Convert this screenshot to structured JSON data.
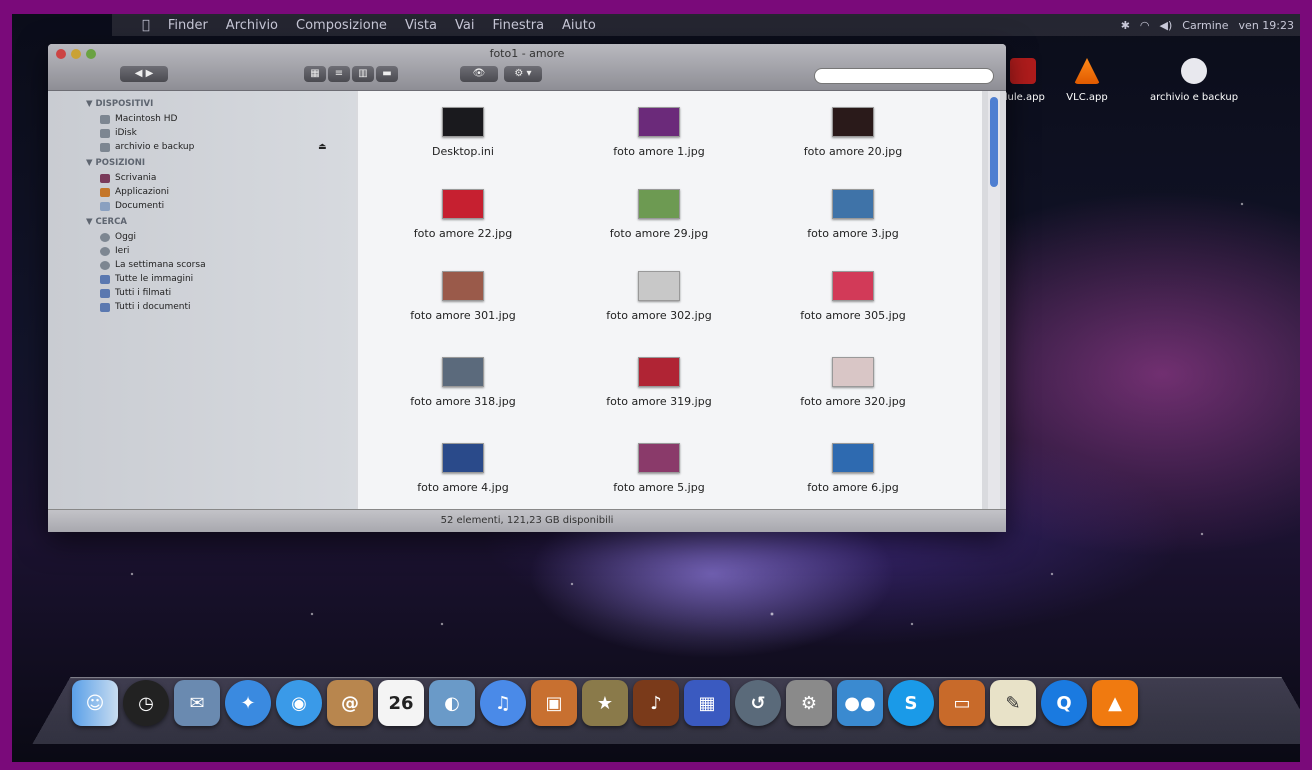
{
  "menubar": {
    "items": [
      "Finder",
      "Archivio",
      "Composizione",
      "Vista",
      "Vai",
      "Finestra",
      "Aiuto"
    ],
    "clock": "ven 19:23",
    "user": "Carmine"
  },
  "window": {
    "title": "foto1 - amore",
    "status": "52 elementi, 121,23 GB disponibili",
    "search_placeholder": ""
  },
  "sidebar": {
    "devices_header": "▼ DISPOSITIVI",
    "devices": [
      "Macintosh HD",
      "iDisk",
      "archivio e backup"
    ],
    "places_header": "▼ POSIZIONI",
    "places": [
      "Scrivania",
      "Applicazioni",
      "Documenti"
    ],
    "search_header": "▼ CERCA",
    "searches": [
      "Oggi",
      "Ieri",
      "La settimana scorsa",
      "Tutte le immagini",
      "Tutti i filmati",
      "Tutti i documenti"
    ]
  },
  "files": [
    {
      "name": "Desktop.ini",
      "color": "#1a1a1e"
    },
    {
      "name": "foto amore 1.jpg",
      "color": "#6b2a7a"
    },
    {
      "name": "foto amore 20.jpg",
      "color": "#2a1a1a"
    },
    {
      "name": "foto amore 22.jpg",
      "color": "#c62030"
    },
    {
      "name": "foto amore 29.jpg",
      "color": "#6d9a52"
    },
    {
      "name": "foto amore 3.jpg",
      "color": "#3f73a8"
    },
    {
      "name": "foto amore 301.jpg",
      "color": "#9a5a4a"
    },
    {
      "name": "foto amore 302.jpg",
      "color": "#c8c8c8"
    },
    {
      "name": "foto amore 305.jpg",
      "color": "#d23a58"
    },
    {
      "name": "foto amore 318.jpg",
      "color": "#5b6a7c"
    },
    {
      "name": "foto amore 319.jpg",
      "color": "#b02434"
    },
    {
      "name": "foto amore 320.jpg",
      "color": "#d9c6c6"
    },
    {
      "name": "foto amore 4.jpg",
      "color": "#2a4a8a"
    },
    {
      "name": "foto amore 5.jpg",
      "color": "#8a3a6a"
    },
    {
      "name": "foto amore 6.jpg",
      "color": "#2e6ab0"
    }
  ],
  "desktop": {
    "icons": [
      "dule.app",
      "VLC.app",
      "archivio e backup"
    ]
  },
  "dock": {
    "icons": [
      "finder-icon",
      "dashboard-icon",
      "mail-icon",
      "safari-icon",
      "ichat-icon",
      "address-book-icon",
      "ical-icon",
      "preview-icon",
      "itunes-icon",
      "iphoto-icon",
      "imovie-icon",
      "garageband-icon",
      "spaces-icon",
      "time-machine-icon",
      "system-prefs-icon",
      "messenger-icon",
      "skype-icon",
      "keynote-icon",
      "textedit-icon",
      "quicktime-icon",
      "vlc-icon",
      "trash-icon"
    ],
    "calendar_day": "26"
  }
}
